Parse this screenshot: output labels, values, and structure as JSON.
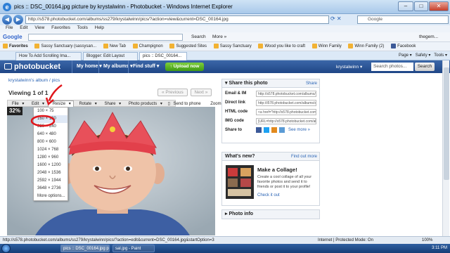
{
  "window": {
    "title": "pics :: DSC_00164.jpg picture by krystalwinn - Photobucket - Windows Internet Explorer"
  },
  "address_bar": {
    "url": "http://s578.photobucket.com/albums/ss279/krystalwinn/pics/?action=view&current=DSC_00164.jpg",
    "search_placeholder": "Google"
  },
  "menu": [
    "File",
    "Edit",
    "View",
    "Favorites",
    "Tools",
    "Help"
  ],
  "google_toolbar": {
    "brand": "Google",
    "search_label": "Search",
    "more_label": "More »",
    "user": "thegem..."
  },
  "favorites": {
    "label": "Favorites",
    "items": [
      "Sassy Sanctuary (sassysan...",
      "New Tab",
      "Champignon",
      "Suggested Sites",
      "Sassy Sanctuary",
      "Wood you like to craft",
      "Winn Family",
      "Winn Family (2)",
      "Facebook"
    ]
  },
  "tabs": [
    {
      "label": "How To Add Scrolling Ima...",
      "active": false
    },
    {
      "label": "Blogger: Edit Layout",
      "active": false
    },
    {
      "label": "pics :: DSC_00164...",
      "active": true
    }
  ],
  "command_bar": [
    "Page",
    "Safety",
    "Tools"
  ],
  "photobucket": {
    "logo": "photobucket",
    "nav": [
      "My home",
      "My albums",
      "Find stuff"
    ],
    "upload": "Upload now",
    "user": "krystalwinn",
    "search_placeholder": "Search photos...",
    "search_btn": "Search"
  },
  "page": {
    "breadcrumb": "krystalwinn's album / pics",
    "viewing": "Viewing 1 of 1",
    "prev": "« Previous",
    "next": "Next »",
    "toolbar": [
      "File",
      "Edit",
      "Resize",
      "Rotate",
      "Share",
      "Photo products",
      "Send to phone",
      "Zoom"
    ],
    "zoom_badge": "32%",
    "resize_options": [
      "100 × 75",
      "160 × 120",
      "320 × 240",
      "640 × 480",
      "800 × 600",
      "1024 × 768",
      "1280 × 960",
      "1600 × 1200",
      "2048 × 1536",
      "2592 × 1944",
      "3648 × 2736",
      "More options..."
    ]
  },
  "share_panel": {
    "title": "Share this photo",
    "link": "Share",
    "rows": [
      {
        "label": "Email & IM",
        "value": "http://s578.photobucket.com/albums/ss2"
      },
      {
        "label": "Direct link",
        "value": "http://i578.photobucket.com/albums/ss2"
      },
      {
        "label": "HTML code",
        "value": "<a href=\"http://s578.photobucket.com/alb"
      },
      {
        "label": "IMG code",
        "value": "[URL=http://s578.photobucket.com/albu"
      },
      {
        "label": "Share to",
        "value": ""
      }
    ],
    "see_more": "See more »"
  },
  "whats_new": {
    "title": "What's new?",
    "link": "Find out more",
    "headline": "Make a Collage!",
    "body": "Create a cool collage of all your favorite photos and send it to friends or post it to your profile!",
    "cta": "Check it out"
  },
  "photo_info": {
    "title": "Photo info"
  },
  "status": {
    "url": "http://s578.photobucket.com/albums/ss279/krystalwinn/pics/?action=edit&current=DSC_00164.jpg&startOption=3",
    "zone": "Internet | Protected Mode: On",
    "zoom": "100%"
  },
  "taskbar": {
    "tasks": [
      "pics :: DSC_00164.jpg pic...",
      "sal.jpg - Paint"
    ],
    "time": "3:11 PM"
  },
  "colors": {
    "pb_blue": "#1f4686",
    "upload_green": "#3f9a14",
    "annotation_red": "#e0161b"
  }
}
